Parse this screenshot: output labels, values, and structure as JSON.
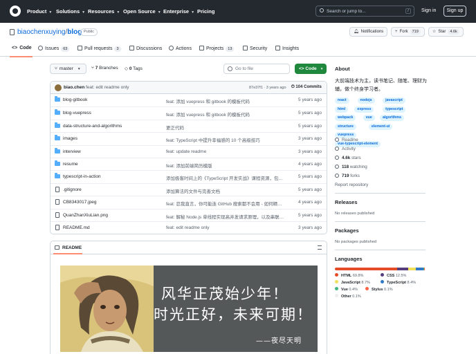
{
  "header": {
    "nav": [
      "Product",
      "Solutions",
      "Resources",
      "Open Source",
      "Enterprise",
      "Pricing"
    ],
    "search_placeholder": "Search or jump to...",
    "search_kbd": "/",
    "sign_in": "Sign in",
    "sign_up": "Sign up"
  },
  "repo": {
    "owner": "biaochenxuying",
    "separator": "/",
    "name": "blog",
    "visibility": "Public",
    "notifications": "Notifications",
    "fork_label": "Fork",
    "fork_count": "719",
    "star_label": "Star",
    "star_count": "4.6k"
  },
  "tabs": [
    {
      "label": "Code",
      "count": ""
    },
    {
      "label": "Issues",
      "count": "63"
    },
    {
      "label": "Pull requests",
      "count": "3"
    },
    {
      "label": "Discussions",
      "count": ""
    },
    {
      "label": "Actions",
      "count": ""
    },
    {
      "label": "Projects",
      "count": "13"
    },
    {
      "label": "Security",
      "count": ""
    },
    {
      "label": "Insights",
      "count": ""
    }
  ],
  "branch": {
    "name": "master",
    "branches": "7 Branches",
    "branches_num": "7",
    "branches_word": "Branches",
    "tags_num": "0",
    "tags_word": "Tags",
    "goto_file": "Go to file",
    "code_button": "Code"
  },
  "latest_commit": {
    "author": "biao.chen",
    "message": "feat: edit readme only",
    "hash_time": "87e37f1 · 3 years ago",
    "commits_num": "104",
    "commits_word": "Commits"
  },
  "files": [
    {
      "type": "dir",
      "name": "blog-gitbook",
      "message": "feat: 添加 vuepress 和 gitbook 的模板代码",
      "time": "5 years ago"
    },
    {
      "type": "dir",
      "name": "blog-vuepress",
      "message": "feat: 添加 vuepress 和 gitbook 的模板代码",
      "time": "5 years ago"
    },
    {
      "type": "dir",
      "name": "data-structure-and-algorithms",
      "message": "更正代码",
      "time": "5 years ago"
    },
    {
      "type": "dir",
      "name": "images",
      "message": "feat: TypeScript 中提升幸福感的 10 个高级技巧",
      "time": "3 years ago"
    },
    {
      "type": "dir",
      "name": "interview",
      "message": "feat: update readme",
      "time": "3 years ago"
    },
    {
      "type": "dir",
      "name": "resume",
      "message": "feat: 添加前端简历模版",
      "time": "4 years ago"
    },
    {
      "type": "dir",
      "name": "typescript-in-action",
      "message": "添加极客时间上的《TypeScript 开发实战》课程资源，包含...",
      "time": "5 years ago"
    },
    {
      "type": "file",
      "name": ".gitignore",
      "message": "添加算法的文件与完善文档",
      "time": "5 years ago"
    },
    {
      "type": "file",
      "name": "CB8343017.jpeg",
      "message": "feat: 忍我直言，你可能连 GitHub 搜索都不会用 - 如何精准...",
      "time": "4 years ago"
    },
    {
      "type": "file",
      "name": "QuanZhanXiuLian.png",
      "message": "feat: 解秘 Node.js 单线程实现高并发请求原理，以及串联同...",
      "time": "5 years ago"
    },
    {
      "type": "file",
      "name": "README.md",
      "message": "feat: edit readme only",
      "time": "3 years ago"
    }
  ],
  "readme": {
    "label": "README",
    "banner_line1": "风华正茂始少年！",
    "banner_line2": "时光正好，未来可期！",
    "banner_signature": "——夜尽天明"
  },
  "about": {
    "heading": "About",
    "description": "大前端技术为主，读书笔记、随笔、理财为辅，做个终身学习者。",
    "topics": [
      "react",
      "nodejs",
      "javascript",
      "html",
      "express",
      "typescript",
      "webpack",
      "vue",
      "algorithms",
      "structure",
      "element-ui",
      "vuepress",
      "vue-typescript-element"
    ],
    "readme_link": "Readme",
    "activity_link": "Activity",
    "stars_num": "4.6k",
    "stars_word": "stars",
    "watching_num": "118",
    "watching_word": "watching",
    "forks_num": "719",
    "forks_word": "forks",
    "report": "Report repository"
  },
  "releases": {
    "heading": "Releases",
    "note": "No releases published"
  },
  "packages": {
    "heading": "Packages",
    "note": "No packages published"
  },
  "languages": {
    "heading": "Languages",
    "items": [
      {
        "name": "HTML",
        "percent": "69.8%",
        "value": 69.8,
        "color": "#e34c26"
      },
      {
        "name": "CSS",
        "percent": "12.5%",
        "value": 12.5,
        "color": "#563d7c"
      },
      {
        "name": "JavaScript",
        "percent": "8.7%",
        "value": 8.7,
        "color": "#f1e05a"
      },
      {
        "name": "TypeScript",
        "percent": "8.4%",
        "value": 8.4,
        "color": "#3178c6"
      },
      {
        "name": "Vue",
        "percent": "0.4%",
        "value": 0.4,
        "color": "#41b883"
      },
      {
        "name": "Stylus",
        "percent": "0.1%",
        "value": 0.1,
        "color": "#ff6347"
      },
      {
        "name": "Other",
        "percent": "0.1%",
        "value": 0.1,
        "color": "#ededed"
      }
    ]
  },
  "colors": {
    "accent": "#1f883d",
    "link": "#0969da",
    "header_bg": "#24292f",
    "tab_underline": "#fd8c73"
  }
}
